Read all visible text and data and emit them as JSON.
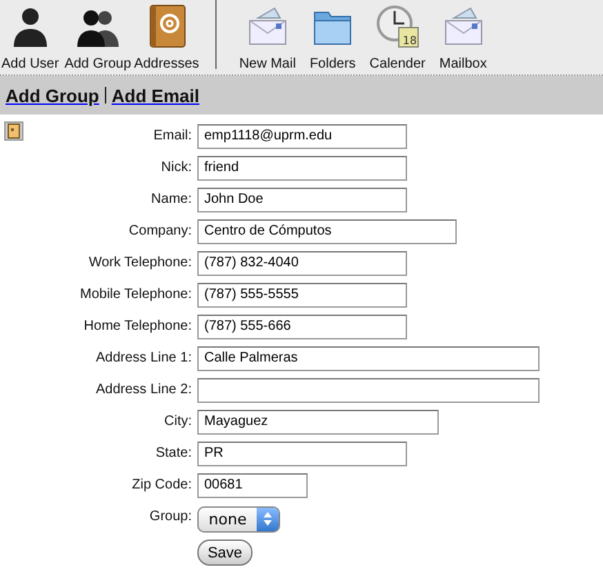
{
  "toolbar": [
    {
      "kind": "user",
      "label": "Add User"
    },
    {
      "kind": "group",
      "label": "Add Group"
    },
    {
      "kind": "book",
      "label": "Addresses"
    },
    {
      "kind": "separator"
    },
    {
      "kind": "mail",
      "label": "New Mail"
    },
    {
      "kind": "folder",
      "label": "Folders"
    },
    {
      "kind": "calendar",
      "label": "Calender",
      "badge": "18"
    },
    {
      "kind": "mail",
      "label": "Mailbox"
    }
  ],
  "links": [
    "Add Group",
    "Add Email"
  ],
  "form": {
    "fields": [
      {
        "label": "Email:",
        "value": "emp1118@uprm.edu"
      },
      {
        "label": "Nick:",
        "value": "friend"
      },
      {
        "label": "Name:",
        "value": "John Doe"
      },
      {
        "label": "Company:",
        "value": "Centro de Cómputos"
      },
      {
        "label": "Work Telephone:",
        "value": "(787) 832-4040"
      },
      {
        "label": "Mobile Telephone:",
        "value": "(787) 555-5555"
      },
      {
        "label": "Home Telephone:",
        "value": "(787) 555-666"
      },
      {
        "label": "Address Line 1:",
        "value": "Calle Palmeras"
      },
      {
        "label": "Address Line 2:"
      },
      {
        "label": "City:",
        "value": "Mayaguez"
      },
      {
        "label": "State:",
        "value": "PR"
      },
      {
        "label": "Zip Code:",
        "value": "00681"
      }
    ],
    "group": {
      "label": "Group:",
      "value": "none"
    },
    "save": "Save"
  }
}
